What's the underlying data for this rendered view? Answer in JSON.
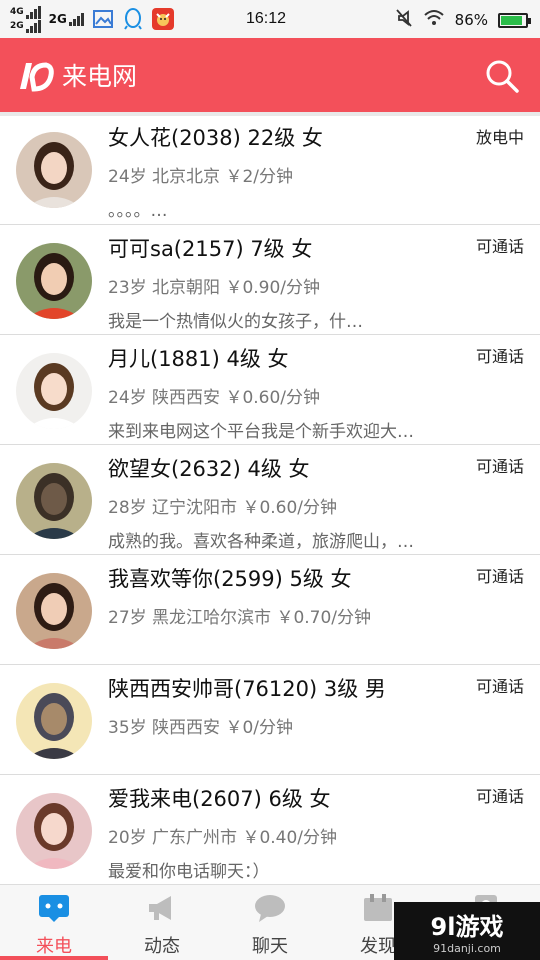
{
  "status_bar": {
    "net1_top": "4G",
    "net1_bottom": "2G",
    "net2": "2G",
    "time": "16:12",
    "battery": "86%",
    "battery_level": 0.86
  },
  "header": {
    "title": "来电网",
    "logo_text": "ID",
    "accent_color": "#f3505a",
    "search_icon": "search-icon"
  },
  "contacts": [
    {
      "name": "女人花(2038) 22级 女",
      "status": "放电中",
      "meta": "24岁  北京北京  ￥2/分钟",
      "desc": "。。。。…"
    },
    {
      "name": "可可sa(2157) 7级 女",
      "status": "可通话",
      "meta": "23岁  北京朝阳  ￥0.90/分钟",
      "desc": "我是一个热情似火的女孩子，什…"
    },
    {
      "name": "月儿(1881) 4级 女",
      "status": "可通话",
      "meta": "24岁  陕西西安  ￥0.60/分钟",
      "desc": "来到来电网这个平台我是个新手欢迎大…"
    },
    {
      "name": "欲望女(2632) 4级 女",
      "status": "可通话",
      "meta": "28岁  辽宁沈阳市  ￥0.60/分钟",
      "desc": "成熟的我。喜欢各种柔道，旅游爬山，…"
    },
    {
      "name": "我喜欢等你(2599) 5级 女",
      "status": "可通话",
      "meta": "27岁  黑龙江哈尔滨市  ￥0.70/分钟",
      "desc": ""
    },
    {
      "name": "陕西西安帅哥(76120) 3级 男",
      "status": "可通话",
      "meta": "35岁  陕西西安  ￥0/分钟",
      "desc": ""
    },
    {
      "name": "爱我来电(2607) 6级 女",
      "status": "可通话",
      "meta": "20岁  广东广州市  ￥0.40/分钟",
      "desc": "最爱和你电话聊天：）"
    }
  ],
  "tabs": [
    {
      "label": "来电",
      "icon": "chat-bubble-icon",
      "active": true
    },
    {
      "label": "动态",
      "icon": "megaphone-icon",
      "active": false
    },
    {
      "label": "聊天",
      "icon": "speech-bubble-icon",
      "active": false
    },
    {
      "label": "发现",
      "icon": "calendar-icon",
      "active": false
    },
    {
      "label": "",
      "icon": "profile-icon",
      "active": false
    }
  ],
  "watermark": {
    "main": "9l游戏",
    "sub": "91danji.com"
  }
}
